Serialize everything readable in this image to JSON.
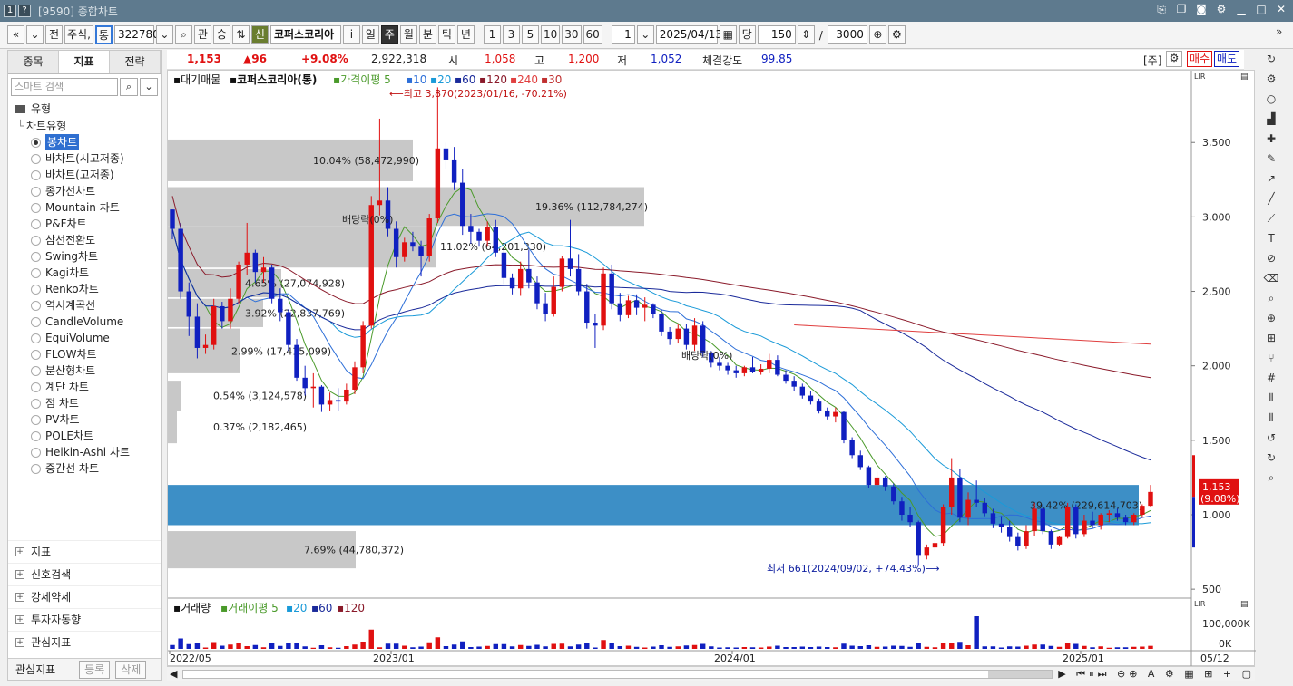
{
  "window": {
    "title": "[9590] 종합차트",
    "icon1": "1",
    "icon2": "?",
    "controls": [
      "link-icon",
      "copy-icon",
      "camera-icon",
      "gear-icon",
      "minimize-icon",
      "maximize-icon",
      "close-icon"
    ]
  },
  "toolbar": {
    "nav_prev": "«",
    "nav_down": "»",
    "market": "전",
    "stock_type": "주식,",
    "type_badge": "통",
    "code": "322780",
    "lookup": "⌕",
    "btn_gwan": "관",
    "btn_seung": "승",
    "badge_sin": "신",
    "stock_name": "코퍼스코리아",
    "info": "i",
    "periods": [
      "일",
      "주",
      "월",
      "분",
      "틱",
      "년"
    ],
    "active_period": "주",
    "intervals": [
      "1",
      "3",
      "5",
      "10",
      "30",
      "60"
    ],
    "period_value": "1",
    "date": "2025/04/13",
    "btn_dang": "당",
    "count": "150",
    "slash": "/",
    "total": "3000"
  },
  "left_panel": {
    "tabs": [
      "종목",
      "지표",
      "전략"
    ],
    "active_tab": "지표",
    "search_placeholder": "스마트 검색",
    "section_type": "유형",
    "chart_type_header": "차트유형",
    "chart_types": [
      "봉차트",
      "바차트(시고저종)",
      "바차트(고저종)",
      "종가선차트",
      "Mountain 차트",
      "P&F차트",
      "삼선전환도",
      "Swing차트",
      "Kagi차트",
      "Renko차트",
      "역시계곡선",
      "CandleVolume",
      "EquiVolume",
      "FLOW차트",
      "분산형차트",
      "계단 차트",
      "점 차트",
      "PV차트",
      "POLE차트",
      "Heikin-Ashi 차트",
      "중간선 차트"
    ],
    "selected_type": "봉차트",
    "groups": [
      "지표",
      "신호검색",
      "강세약세",
      "투자자동향",
      "관심지표"
    ],
    "bottom": {
      "label": "관심지표",
      "register": "등록",
      "delete": "삭제"
    }
  },
  "info_bar": {
    "price": "1,153",
    "change": "▲96",
    "change_pct": "+9.08%",
    "volume": "2,922,318",
    "open_label": "시",
    "open": "1,058",
    "high_label": "고",
    "high": "1,200",
    "low_label": "저",
    "low": "1,052",
    "strength_label": "체결강도",
    "strength": "99.85",
    "unit": "[주]",
    "buy": "매수",
    "sell": "매도"
  },
  "legend": {
    "volume_profile": "대기매물",
    "stock": "코퍼스코리아(통)",
    "ma_label": "가격이평",
    "ma_periods": [
      "5",
      "10",
      "20",
      "60",
      "120",
      "240",
      "30"
    ],
    "ma_colors": [
      "#4a9a2a",
      "#2d6fd8",
      "#1a9ad8",
      "#1a2a9a",
      "#8a1a2a",
      "#e04040",
      "#c03030"
    ]
  },
  "volume_legend": {
    "title": "거래량",
    "ma_label": "거래이평",
    "periods": [
      "5",
      "20",
      "60",
      "120"
    ]
  },
  "annotations": {
    "high": "최고 3,870(2023/01/16, -70.21%)",
    "low": "최저 661(2024/09/02, +74.43%)",
    "dividend": "배당락(0%)",
    "current_price": "1,153",
    "current_pct": "(9.08%)"
  },
  "volume_profile_bars": [
    {
      "label": "10.04% (58,472,990)",
      "highlight": false
    },
    {
      "label": "19.36% (112,784,274)",
      "highlight": false
    },
    {
      "label": "11.02% (64,201,330)",
      "highlight": false
    },
    {
      "label": "4.65% (27,074,928)",
      "highlight": false
    },
    {
      "label": "3.92% (22,837,769)",
      "highlight": false
    },
    {
      "label": "2.99% (17,415,099)",
      "highlight": false
    },
    {
      "label": "0.54% (3,124,578)",
      "highlight": false
    },
    {
      "label": "0.37% (2,182,465)",
      "highlight": false
    },
    {
      "label": "39.42% (229,614,703)",
      "highlight": true
    },
    {
      "label": "7.69% (44,780,372)",
      "highlight": false
    }
  ],
  "y_axis_ticks": [
    "3,500",
    "3,000",
    "2,500",
    "2,000",
    "1,500",
    "1,000",
    "500"
  ],
  "volume_axis_ticks": [
    "100,000K",
    "0K"
  ],
  "x_axis_ticks": [
    "2022/05",
    "2023/01",
    "2024/01",
    "2025/01",
    "05/12"
  ],
  "axis_buttons": [
    "LIR",
    "▤"
  ],
  "colors": {
    "up": "#e01010",
    "down": "#1020c0",
    "highlight_zone": "#3d8fc6",
    "profile_gray": "#c8c8c8",
    "current_tag": "#e01010"
  },
  "chart_data": {
    "type": "candlestick",
    "ylim": [
      440,
      3970
    ],
    "candles": [
      [
        3050,
        3050,
        2850,
        2920
      ],
      [
        2920,
        2960,
        2450,
        2500
      ],
      [
        2500,
        2560,
        2200,
        2330
      ],
      [
        2330,
        2420,
        2050,
        2120
      ],
      [
        2120,
        2210,
        2080,
        2140
      ],
      [
        2140,
        2450,
        2110,
        2400
      ],
      [
        2400,
        2430,
        2250,
        2300
      ],
      [
        2300,
        2520,
        2250,
        2450
      ],
      [
        2450,
        2700,
        2420,
        2680
      ],
      [
        2680,
        2960,
        2610,
        2760
      ],
      [
        2760,
        2780,
        2560,
        2630
      ],
      [
        2630,
        2730,
        2560,
        2660
      ],
      [
        2660,
        2680,
        2420,
        2450
      ],
      [
        2450,
        2520,
        2300,
        2360
      ],
      [
        2360,
        2380,
        2100,
        2140
      ],
      [
        2140,
        2180,
        1900,
        1920
      ],
      [
        1920,
        2000,
        1800,
        1850
      ],
      [
        1850,
        1950,
        1720,
        1860
      ],
      [
        1860,
        1870,
        1690,
        1740
      ],
      [
        1740,
        1820,
        1700,
        1770
      ],
      [
        1770,
        1850,
        1700,
        1760
      ],
      [
        1760,
        1880,
        1740,
        1840
      ],
      [
        1840,
        2030,
        1810,
        1990
      ],
      [
        1990,
        2300,
        1950,
        2270
      ],
      [
        2270,
        3140,
        2250,
        3080
      ],
      [
        3080,
        3660,
        3010,
        3110
      ],
      [
        3110,
        3200,
        2870,
        2920
      ],
      [
        2920,
        2970,
        2660,
        2730
      ],
      [
        2730,
        2860,
        2700,
        2830
      ],
      [
        2830,
        2900,
        2770,
        2800
      ],
      [
        2800,
        2840,
        2600,
        2740
      ],
      [
        2740,
        3020,
        2700,
        2990
      ],
      [
        2990,
        3870,
        2960,
        3460
      ],
      [
        3460,
        3500,
        3320,
        3380
      ],
      [
        3380,
        3470,
        3180,
        3230
      ],
      [
        3230,
        3320,
        2880,
        2940
      ],
      [
        2940,
        3020,
        2820,
        2900
      ],
      [
        2900,
        2920,
        2800,
        2840
      ],
      [
        2840,
        2970,
        2800,
        2930
      ],
      [
        2930,
        2980,
        2730,
        2760
      ],
      [
        2760,
        2790,
        2550,
        2590
      ],
      [
        2590,
        2620,
        2480,
        2520
      ],
      [
        2520,
        2700,
        2470,
        2650
      ],
      [
        2650,
        2780,
        2520,
        2560
      ],
      [
        2560,
        2600,
        2380,
        2420
      ],
      [
        2420,
        2490,
        2300,
        2350
      ],
      [
        2350,
        2600,
        2330,
        2530
      ],
      [
        2530,
        2740,
        2500,
        2720
      ],
      [
        2720,
        2980,
        2600,
        2650
      ],
      [
        2650,
        2750,
        2470,
        2500
      ],
      [
        2500,
        2550,
        2250,
        2290
      ],
      [
        2290,
        2350,
        2120,
        2270
      ],
      [
        2270,
        2660,
        2240,
        2620
      ],
      [
        2620,
        2680,
        2380,
        2420
      ],
      [
        2420,
        2490,
        2300,
        2340
      ],
      [
        2340,
        2470,
        2320,
        2440
      ],
      [
        2440,
        2480,
        2340,
        2390
      ],
      [
        2390,
        2460,
        2300,
        2410
      ],
      [
        2410,
        2420,
        2320,
        2350
      ],
      [
        2350,
        2380,
        2200,
        2230
      ],
      [
        2230,
        2260,
        2140,
        2180
      ],
      [
        2180,
        2280,
        2150,
        2250
      ],
      [
        2250,
        2280,
        2110,
        2140
      ],
      [
        2140,
        2320,
        2100,
        2270
      ],
      [
        2270,
        2300,
        2060,
        2090
      ],
      [
        2090,
        2100,
        1990,
        2020
      ],
      [
        2020,
        2060,
        1970,
        2000
      ],
      [
        2000,
        2020,
        1940,
        1970
      ],
      [
        1970,
        2000,
        1920,
        1950
      ],
      [
        1950,
        2000,
        1930,
        1990
      ],
      [
        1990,
        2060,
        1950,
        1960
      ],
      [
        1960,
        2010,
        1940,
        1980
      ],
      [
        1980,
        2080,
        1950,
        2040
      ],
      [
        2040,
        2070,
        1930,
        1940
      ],
      [
        1940,
        1970,
        1880,
        1900
      ],
      [
        1900,
        1930,
        1830,
        1860
      ],
      [
        1860,
        1880,
        1780,
        1800
      ],
      [
        1800,
        1830,
        1740,
        1760
      ],
      [
        1760,
        1780,
        1680,
        1700
      ],
      [
        1700,
        1720,
        1640,
        1660
      ],
      [
        1660,
        1720,
        1620,
        1690
      ],
      [
        1690,
        1700,
        1480,
        1500
      ],
      [
        1500,
        1520,
        1380,
        1400
      ],
      [
        1400,
        1430,
        1300,
        1320
      ],
      [
        1320,
        1330,
        1180,
        1200
      ],
      [
        1200,
        1290,
        1180,
        1250
      ],
      [
        1250,
        1260,
        1160,
        1190
      ],
      [
        1190,
        1210,
        1070,
        1090
      ],
      [
        1090,
        1120,
        960,
        1000
      ],
      [
        1000,
        1050,
        920,
        950
      ],
      [
        950,
        960,
        661,
        730
      ],
      [
        730,
        800,
        700,
        780
      ],
      [
        780,
        830,
        760,
        810
      ],
      [
        810,
        1070,
        790,
        1050
      ],
      [
        1050,
        1380,
        1000,
        1250
      ],
      [
        1250,
        1310,
        950,
        980
      ],
      [
        980,
        1150,
        930,
        1100
      ],
      [
        1100,
        1230,
        1050,
        1080
      ],
      [
        1080,
        1110,
        990,
        1010
      ],
      [
        1010,
        1040,
        910,
        940
      ],
      [
        940,
        990,
        880,
        920
      ],
      [
        920,
        960,
        820,
        850
      ],
      [
        850,
        880,
        760,
        790
      ],
      [
        790,
        930,
        770,
        890
      ],
      [
        890,
        1080,
        860,
        1040
      ],
      [
        1040,
        1070,
        870,
        890
      ],
      [
        890,
        900,
        770,
        800
      ],
      [
        800,
        860,
        790,
        850
      ],
      [
        850,
        1080,
        840,
        1050
      ],
      [
        1050,
        1070,
        840,
        870
      ],
      [
        870,
        1000,
        850,
        960
      ],
      [
        960,
        1020,
        910,
        930
      ],
      [
        930,
        1010,
        900,
        1000
      ],
      [
        1000,
        1030,
        950,
        1010
      ],
      [
        1010,
        1040,
        960,
        980
      ],
      [
        980,
        1000,
        930,
        950
      ],
      [
        950,
        1010,
        930,
        1000
      ],
      [
        1000,
        1070,
        980,
        1060
      ],
      [
        1060,
        1200,
        1052,
        1153
      ]
    ],
    "ma_lines": [
      {
        "color": "#4a9a2a",
        "period": "5"
      },
      {
        "color": "#2d6fd8",
        "period": "10"
      },
      {
        "color": "#1a9ad8",
        "period": "20"
      },
      {
        "color": "#1a2a9a",
        "period": "60"
      },
      {
        "color": "#8a1a2a",
        "period": "120"
      },
      {
        "color": "#e04040",
        "period": "240"
      }
    ]
  }
}
